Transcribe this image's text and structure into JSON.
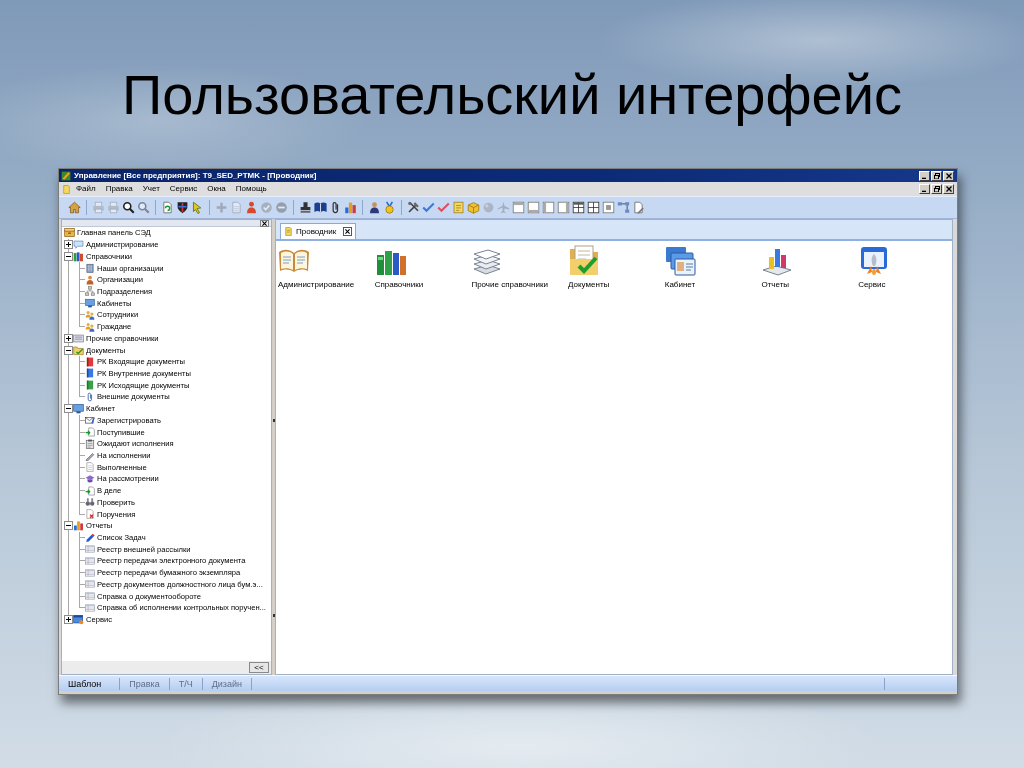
{
  "slide_title": "Пользовательский интерфейс",
  "window": {
    "title": "Управление [Все предприятия]: T9_SED_PTMK - [Проводник]"
  },
  "menu": [
    "Файл",
    "Правка",
    "Учет",
    "Сервис",
    "Окна",
    "Помощь"
  ],
  "toolbar_groups": [
    {
      "buttons": [
        {
          "disabled": false
        }
      ]
    },
    {
      "buttons": [
        {
          "disabled": true
        },
        {
          "disabled": true
        },
        {
          "disabled": false
        },
        {
          "disabled": true
        }
      ]
    },
    {
      "buttons": [
        {
          "disabled": false
        },
        {
          "disabled": false
        },
        {
          "disabled": false
        }
      ]
    },
    {
      "buttons": [
        {
          "disabled": true
        },
        {
          "disabled": true
        },
        {
          "disabled": false
        },
        {
          "disabled": true
        },
        {
          "disabled": true
        }
      ]
    },
    {
      "buttons": [
        {
          "disabled": false
        },
        {
          "disabled": false
        },
        {
          "disabled": false
        },
        {
          "disabled": false
        }
      ]
    },
    {
      "buttons": [
        {
          "disabled": false
        },
        {
          "disabled": false
        }
      ]
    },
    {
      "buttons": [
        {
          "disabled": false
        },
        {
          "disabled": false
        },
        {
          "disabled": false
        },
        {
          "disabled": false
        },
        {
          "disabled": false
        },
        {
          "disabled": true
        },
        {
          "disabled": true
        },
        {
          "disabled": false
        },
        {
          "disabled": false
        },
        {
          "disabled": false
        },
        {
          "disabled": false
        },
        {
          "disabled": false
        },
        {
          "disabled": false
        },
        {
          "disabled": false
        },
        {
          "disabled": false
        },
        {
          "disabled": false
        }
      ]
    }
  ],
  "navigation_tree": [
    {
      "label": "Главная панель СЭД",
      "children": [
        {
          "label": "Администрирование",
          "expanded": false
        },
        {
          "label": "Справочники",
          "expanded": true,
          "children": [
            {
              "label": "Наши организации"
            },
            {
              "label": "Организации"
            },
            {
              "label": "Подразделения"
            },
            {
              "label": "Кабинеты"
            },
            {
              "label": "Сотрудники"
            },
            {
              "label": "Граждане"
            }
          ]
        },
        {
          "label": "Прочие справочники",
          "expanded": false
        },
        {
          "label": "Документы",
          "expanded": true,
          "children": [
            {
              "label": "РК Входящие документы"
            },
            {
              "label": "РК Внутренние документы"
            },
            {
              "label": "РК Исходящие документы"
            },
            {
              "label": "Внешние документы"
            }
          ]
        },
        {
          "label": "Кабинет",
          "expanded": true,
          "children": [
            {
              "label": "Зарегистрировать"
            },
            {
              "label": "Поступившие"
            },
            {
              "label": "Ожидают исполнения"
            },
            {
              "label": "На исполнении"
            },
            {
              "label": "Выполненные"
            },
            {
              "label": "На рассмотрении"
            },
            {
              "label": "В деле"
            },
            {
              "label": "Проверить"
            },
            {
              "label": "Поручения"
            }
          ]
        },
        {
          "label": "Отчеты",
          "expanded": true,
          "children": [
            {
              "label": "Список Задач"
            },
            {
              "label": "Реестр внешней рассылки"
            },
            {
              "label": "Реестр передачи электронного документа"
            },
            {
              "label": "Реестр передачи бумажного экземпляра"
            },
            {
              "label": "Реестр документов должностного лица бум.э..."
            },
            {
              "label": "Справка о документообороте"
            },
            {
              "label": "Справка об исполнении контрольных поручен..."
            }
          ]
        },
        {
          "label": "Сервис",
          "expanded": false
        }
      ]
    }
  ],
  "collapse_button": "<<",
  "tabs": [
    {
      "label": "Проводник",
      "selected": true
    }
  ],
  "explorer_items": [
    "Администрирование",
    "Справочники",
    "Прочие справочники",
    "Документы",
    "Кабинет",
    "Отчеты",
    "Сервис"
  ],
  "mode_tabs": [
    {
      "label": "Шаблон",
      "disabled": false
    },
    {
      "label": "Правка",
      "disabled": true
    },
    {
      "label": "Т/Ч",
      "disabled": true
    },
    {
      "label": "Дизайн",
      "disabled": true
    }
  ]
}
